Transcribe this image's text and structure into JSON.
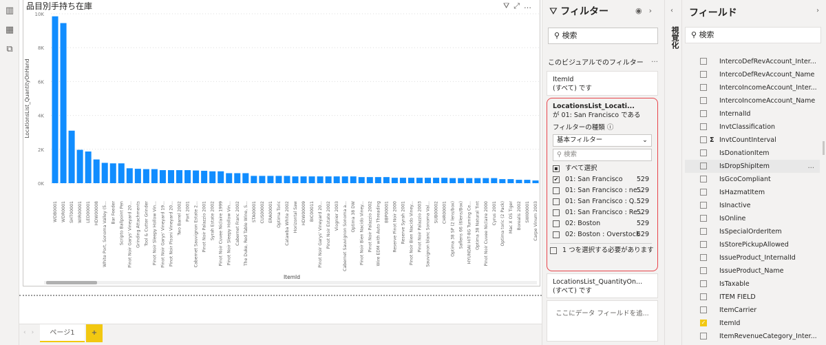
{
  "rail": {
    "icons": [
      "report-view-icon",
      "data-view-icon",
      "model-view-icon"
    ]
  },
  "visual": {
    "title": "品目別手持ち在庫",
    "header_icons": [
      "filter-icon",
      "focus-mode-icon",
      "more-options-icon"
    ],
    "more": "…"
  },
  "chart_data": {
    "type": "bar",
    "title": "品目別手持ち在庫",
    "xlabel": "ItemId",
    "ylabel": "LocationsList_QuantityOnHand",
    "ylim": [
      0,
      10000
    ],
    "yticks": [
      "0K",
      "2K",
      "4K",
      "6K",
      "8K",
      "10K"
    ],
    "grid": true,
    "color": "#118DFF",
    "categories": [
      "WDB0001",
      "WDR0001",
      "SHT00001",
      "WIR00001",
      "LED00001",
      "HDW00008",
      "White Port, Sonoma Valley (5...",
      "Bar Feeder",
      "Scripto Ballpoint Pen",
      "Pinot Noir Garys' Vineyard 20...",
      "Grinding Attachments",
      "Tool & Cutter Grinder",
      "Pinot Noir Sleepy Hollow Vin...",
      "Pinot Noir Garys' Vineyard 19...",
      "Pinot Noir Pisoni Vineyard 20...",
      "Two Barrel 2002",
      "Port 2001",
      "Cabernet Sauvignon Estate 2...",
      "Pinot Noir Palazzio 2001",
      "Syrah Estate 2002",
      "Pinot Noir Cuvee Niclaire 1999",
      "Pinot Noir Sleepy Hollow Vin...",
      "Cabernet Franc 2002",
      "The Duke, Red Table Wine, S...",
      "STA00001",
      "CUS00002",
      "ERA00001",
      "Optima Toric",
      "Catawba White 2002",
      "Horizontal Saw",
      "HDW00009",
      "BIC00011",
      "Pinot Noir Garys' Vineyard 20...",
      "Pinot Noir Estate 2002",
      "Viognier 2003",
      "Cabernet Sauvignon Sonoma a...",
      "Optima 38 DW",
      "Pinot Noir Bien Nacido Viney...",
      "Pinot Noir Palazzio 2002",
      "Wire EDM with Auto Threading",
      "BBP00001",
      "Reserve Pinot Noir 2000",
      "Reserve Syrah 2001",
      "Pinot Noir Bien Nacido Viney...",
      "Pinot Noir Palazzio 2003",
      "Sauvignon blanc Sonoma Val...",
      "SUB00002",
      "CHR00001",
      "Optima 38 SP (2 lens/box)",
      "Saflens 66 (6lens/Box)",
      "HYUNDAI HiT-8G Turning Ce...",
      "Optima 38 Natural Tint",
      "Pinot Noir Cuvee Niclaire 2000",
      "Cyrus 2001",
      "Optima toric (2 Pack)",
      "Mac X OS Tiger",
      "Borealis 2002",
      "SWI00001",
      "Carpe Vinum 2003"
    ],
    "values": [
      9850,
      9450,
      3100,
      1970,
      1870,
      1400,
      1200,
      1170,
      1170,
      880,
      850,
      830,
      830,
      770,
      770,
      770,
      770,
      750,
      730,
      700,
      700,
      590,
      590,
      590,
      430,
      430,
      430,
      430,
      430,
      400,
      400,
      400,
      400,
      400,
      400,
      400,
      400,
      360,
      360,
      360,
      360,
      320,
      320,
      320,
      320,
      320,
      320,
      320,
      300,
      300,
      300,
      300,
      300,
      300,
      240,
      240,
      200,
      200,
      160
    ]
  },
  "pages": {
    "tab": "ページ1",
    "add": "+",
    "prev": "‹",
    "next": "›"
  },
  "filters": {
    "title": "フィルター",
    "search_placeholder": "検索",
    "section": "このビジュアルでのフィルター",
    "section_more": "…",
    "cards": [
      {
        "field": "ItemId",
        "state": "(すべて) です"
      },
      {
        "field": "LocationsList_Locati...",
        "state": "が 01: San Francisco である",
        "type_label": "フィルターの種類",
        "type_value": "基本フィルター",
        "search_placeholder": "検索",
        "select_all": "すべて選択",
        "items": [
          {
            "label": "01: San Francisco",
            "count": "529",
            "checked": true
          },
          {
            "label": "01: San Francisco : ne...",
            "count": "529",
            "checked": false
          },
          {
            "label": "01: San Francisco : Q...",
            "count": "529",
            "checked": false
          },
          {
            "label": "01: San Francisco : Re...",
            "count": "529",
            "checked": false
          },
          {
            "label": "02: Boston",
            "count": "529",
            "checked": false
          },
          {
            "label": "02: Boston : Overstock",
            "count": "529",
            "checked": false
          }
        ],
        "require_one": "1 つを選択する必要があります"
      },
      {
        "field": "LocationsList_QuantityOn...",
        "state": "(すべて) です"
      }
    ],
    "add_field": "ここにデータ フィールドを追..."
  },
  "visualizations": {
    "label": "視覚化"
  },
  "fields": {
    "title": "フィールド",
    "search_placeholder": "検索",
    "items": [
      {
        "name": "IntercoDefRevAccount_Inter...",
        "checked": false
      },
      {
        "name": "IntercoDefRevAccount_Name",
        "checked": false
      },
      {
        "name": "IntercoIncomeAccount_Inter...",
        "checked": false
      },
      {
        "name": "IntercoIncomeAccount_Name",
        "checked": false
      },
      {
        "name": "InternalId",
        "checked": false
      },
      {
        "name": "InvtClassification",
        "checked": false
      },
      {
        "name": "InvtCountInterval",
        "checked": false,
        "sigma": "Σ"
      },
      {
        "name": "IsDonationItem",
        "checked": false
      },
      {
        "name": "IsDropShipItem",
        "checked": false,
        "more": "…"
      },
      {
        "name": "IsGcoCompliant",
        "checked": false
      },
      {
        "name": "IsHazmatItem",
        "checked": false
      },
      {
        "name": "IsInactive",
        "checked": false
      },
      {
        "name": "IsOnline",
        "checked": false
      },
      {
        "name": "IsSpecialOrderItem",
        "checked": false
      },
      {
        "name": "IsStorePickupAllowed",
        "checked": false
      },
      {
        "name": "IssueProduct_InternalId",
        "checked": false
      },
      {
        "name": "IssueProduct_Name",
        "checked": false
      },
      {
        "name": "IsTaxable",
        "checked": false
      },
      {
        "name": "ITEM FIELD",
        "checked": false
      },
      {
        "name": "ItemCarrier",
        "checked": false
      },
      {
        "name": "ItemId",
        "checked": true
      },
      {
        "name": "ItemRevenueCategory_Inter...",
        "checked": false
      }
    ]
  }
}
